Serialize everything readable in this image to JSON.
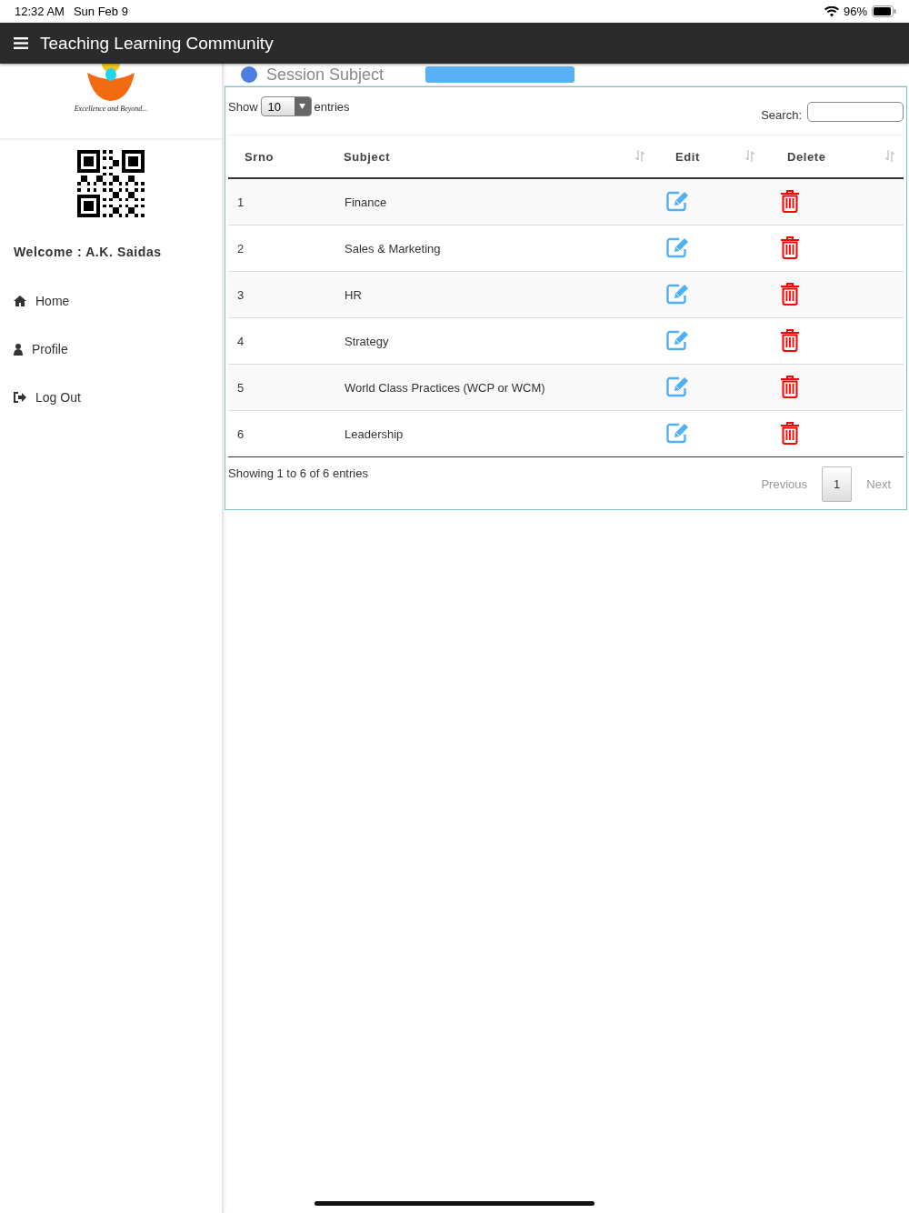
{
  "status_bar": {
    "time": "12:32 AM",
    "date": "Sun Feb 9",
    "battery": "96%"
  },
  "header": {
    "title": "Teaching Learning Community"
  },
  "sidebar": {
    "logo_tagline": "Excellence and Beyond...",
    "welcome": "Welcome : A.K. Saidas",
    "items": [
      {
        "label": "Home",
        "kind": "home"
      },
      {
        "label": "Profile",
        "kind": "profile"
      },
      {
        "label": "Log Out",
        "kind": "logout"
      }
    ]
  },
  "page": {
    "title": "Session Subject"
  },
  "table_controls": {
    "show_label": "Show",
    "page_size": "10",
    "entries_label": "entries",
    "search_label": "Search:"
  },
  "table": {
    "columns": [
      {
        "label": "Srno",
        "sortable": false
      },
      {
        "label": "Subject",
        "sortable": true
      },
      {
        "label": "Edit",
        "sortable": true
      },
      {
        "label": "Delete",
        "sortable": true
      }
    ],
    "rows": [
      {
        "srno": "1",
        "subject": "Finance"
      },
      {
        "srno": "2",
        "subject": "Sales & Marketing"
      },
      {
        "srno": "3",
        "subject": "HR"
      },
      {
        "srno": "4",
        "subject": "Strategy"
      },
      {
        "srno": "5",
        "subject": "World Class Practices (WCP or WCM)"
      },
      {
        "srno": "6",
        "subject": "Leadership"
      }
    ]
  },
  "footer": {
    "info": "Showing 1 to 6 of 6 entries",
    "previous": {
      "label": "Previous",
      "disabled": true
    },
    "pages": [
      {
        "label": "1",
        "selected": true
      }
    ],
    "next": {
      "label": "Next",
      "disabled": true
    }
  }
}
